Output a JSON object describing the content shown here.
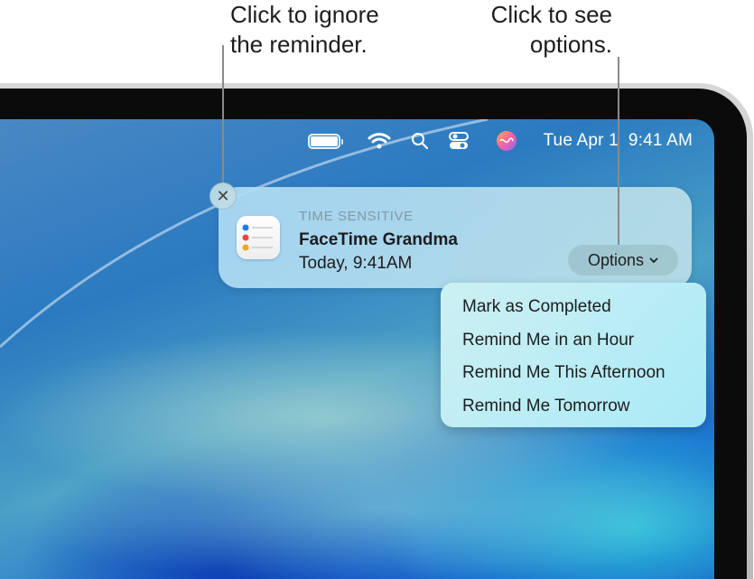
{
  "callouts": {
    "close": [
      "Click to ignore",
      "the reminder."
    ],
    "options": [
      "Click to see",
      "options."
    ]
  },
  "menubar": {
    "icons": [
      "battery-icon",
      "wifi-icon",
      "search-icon",
      "control-center-icon",
      "siri-icon"
    ],
    "clock": "Tue Apr 1  9:41 AM"
  },
  "notification": {
    "category": "TIME SENSITIVE",
    "title": "FaceTime Grandma",
    "time": "Today, 9:41AM",
    "options_label": "Options",
    "close_glyph": "✕"
  },
  "options_menu": {
    "items": [
      "Mark as Completed",
      "Remind Me in an Hour",
      "Remind Me This Afternoon",
      "Remind Me Tomorrow"
    ]
  }
}
